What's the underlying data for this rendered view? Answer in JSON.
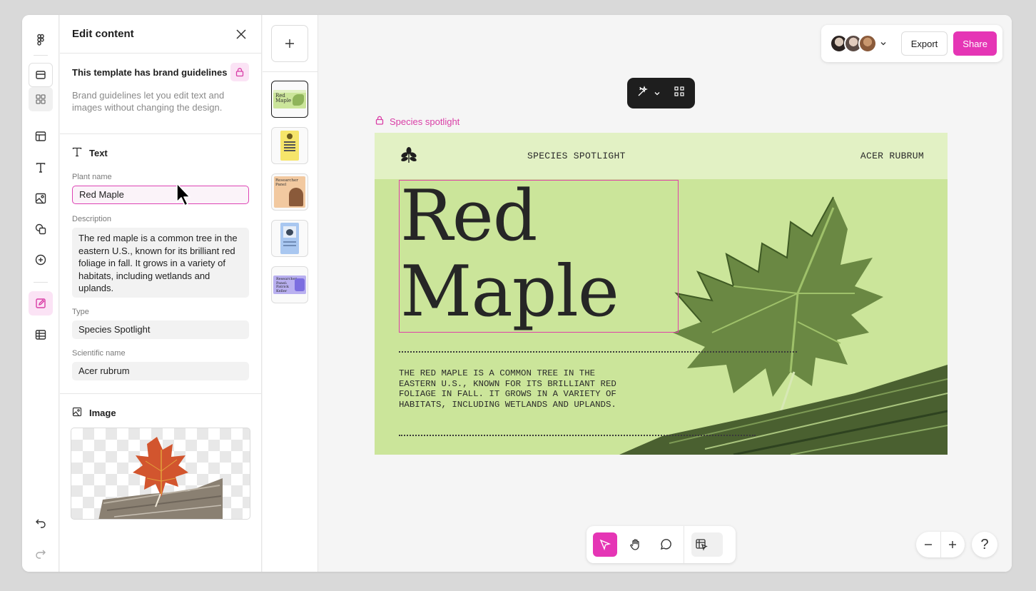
{
  "edit_panel": {
    "title": "Edit content",
    "brand": {
      "title": "This template has brand guidelines",
      "description": "Brand guidelines let you edit text and images without changing the design."
    },
    "text_section": {
      "title": "Text",
      "fields": {
        "plant_name": {
          "label": "Plant name",
          "value": "Red Maple"
        },
        "description": {
          "label": "Description",
          "value": "The red maple is a common tree in the eastern U.S., known for its brilliant red foliage in fall. It grows in a variety of habitats, including wetlands and uplands."
        },
        "type": {
          "label": "Type",
          "value": "Species Spotlight"
        },
        "scientific_name": {
          "label": "Scientific name",
          "value": "Acer rubrum"
        }
      }
    },
    "image_section": {
      "title": "Image"
    }
  },
  "toolbar": {
    "export_label": "Export",
    "share_label": "Share"
  },
  "frame": {
    "label": "Species spotlight",
    "kicker_left": "SPECIES SPOTLIGHT",
    "kicker_right": "ACER RUBRUM",
    "title_line1": "Red",
    "title_line2": "Maple",
    "body": "THE RED MAPLE IS A COMMON TREE IN THE EASTERN U.S., KNOWN FOR ITS BRILLIANT RED FOLIAGE IN FALL. IT GROWS IN A VARIETY OF HABITATS, INCLUDING WETLANDS AND UPLANDS."
  },
  "thumbnails": [
    {
      "text": "Red Maple",
      "bg": "#cbe59a"
    },
    {
      "text": "",
      "bg": "#f6e56a"
    },
    {
      "text": "Researcher Panel",
      "bg": "#f2c9a0"
    },
    {
      "text": "",
      "bg": "#a9c7f0"
    },
    {
      "text": "Researcher Panel: Patrick Keller",
      "bg": "#b9b0f0"
    }
  ],
  "zoom": {
    "minus": "−",
    "plus": "+"
  },
  "help_label": "?",
  "colors": {
    "accent": "#e535b5",
    "canvas_green": "#cbe59a",
    "header_green": "#e2f1c4"
  }
}
